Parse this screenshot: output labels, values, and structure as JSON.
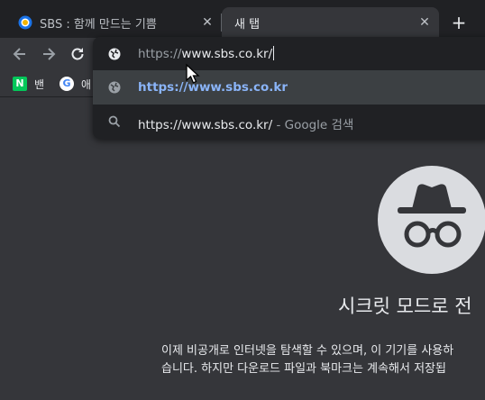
{
  "tabs": [
    {
      "title": "SBS : 함께 만드는 기쁨",
      "close": "✕"
    },
    {
      "title": "새 탭",
      "close": "✕"
    }
  ],
  "new_tab_symbol": "+",
  "omnibox": {
    "input_scheme": "https://",
    "input_host": "www.sbs.co.kr/",
    "suggestions": [
      {
        "icon": "globe-icon",
        "text": "https://www.sbs.co.kr",
        "suffix": ""
      },
      {
        "icon": "search-icon",
        "text": "https://www.sbs.co.kr/",
        "suffix": " - Google 검색"
      }
    ]
  },
  "bookmarks": [
    {
      "icon_letter": "N",
      "label": "밴"
    },
    {
      "icon_letter": "G",
      "label": "애"
    }
  ],
  "incognito": {
    "title": "시크릿 모드로 전",
    "body_line1": "이제 비공개로 인터넷을 탐색할 수 있으며, 이 기기를 사용하",
    "body_line2": "습니다. 하지만 다운로드 파일과 북마크는 계속해서 저장됩"
  },
  "colors": {
    "tabstrip_bg": "#202124",
    "toolbar_bg": "#35363a",
    "link_blue": "#8ab4f8",
    "naver_green": "#03c75a"
  }
}
